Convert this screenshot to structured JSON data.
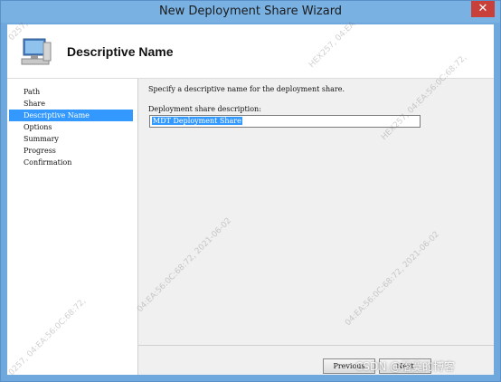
{
  "window": {
    "title": "New Deployment Share Wizard",
    "close_glyph": "✕"
  },
  "header": {
    "title": "Descriptive Name",
    "icon": "computer-icon"
  },
  "nav": {
    "items": [
      {
        "label": "Path",
        "selected": false
      },
      {
        "label": "Share",
        "selected": false
      },
      {
        "label": "Descriptive Name",
        "selected": true
      },
      {
        "label": "Options",
        "selected": false
      },
      {
        "label": "Summary",
        "selected": false
      },
      {
        "label": "Progress",
        "selected": false
      },
      {
        "label": "Confirmation",
        "selected": false
      }
    ]
  },
  "main": {
    "instruction": "Specify a descriptive name for the deployment share.",
    "field_label": "Deployment share description:",
    "field_value": "MDT Deployment Share"
  },
  "footer": {
    "previous_label": "Previous",
    "next_label": "Next"
  },
  "overlay": {
    "watermarks": [
      "04:EA:56:0C:68:72, 2021-06-02",
      "04:EA:56:0C:68:72, 2021-06-02",
      "HEX257, 04:EA",
      "HEX257, 04:EA:56:0C:68:72,",
      "0257,",
      "0257, 04:EA:56:0C:68:72,"
    ],
    "site_mark": "CSDN @落寞的博客"
  },
  "colors": {
    "titlebar": "#79b1e2",
    "selection": "#3399ff",
    "close": "#c9403a"
  }
}
